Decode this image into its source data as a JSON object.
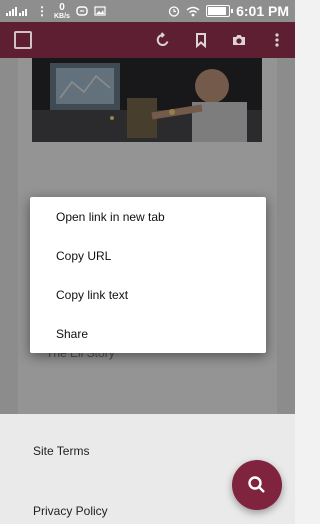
{
  "status_bar": {
    "network_speed_value": "0",
    "network_speed_unit": "KB/s",
    "battery_level": 0.9,
    "time": "6:01 PM"
  },
  "app_bar": {
    "icons": [
      "menu-square-icon",
      "refresh-icon",
      "bookmark-icon",
      "camera-icon",
      "more-vert-icon"
    ]
  },
  "context_menu": {
    "items": [
      "Open link in new tab",
      "Copy URL",
      "Copy link text",
      "Share"
    ]
  },
  "partial_text": "The Eli Story",
  "footer": {
    "site_terms": "Site Terms",
    "privacy_policy": "Privacy Policy"
  },
  "colors": {
    "app_bar": "#5e1f33",
    "fab": "#80233f",
    "status_bar": "#8e8e8e"
  }
}
